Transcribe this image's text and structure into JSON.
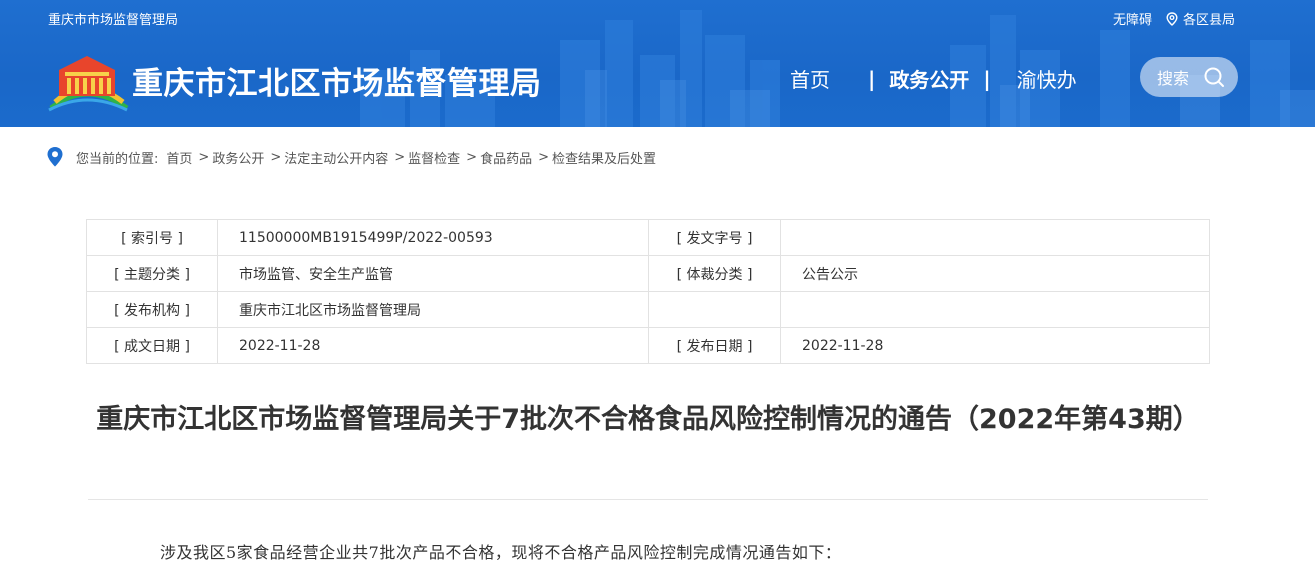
{
  "topbar": {
    "site_name": "重庆市市场监督管理局",
    "accessibility": "无障碍",
    "districts": "各区县局"
  },
  "header": {
    "title": "重庆市江北区市场监督管理局"
  },
  "nav": {
    "items": [
      "首页",
      "政务公开",
      "渝快办"
    ],
    "active_index": 1,
    "search_label": "搜索"
  },
  "breadcrumb": {
    "prefix": "您当前的位置:",
    "items": [
      "首页",
      "政务公开",
      "法定主动公开内容",
      "监督检查",
      "食品药品",
      "检查结果及后处置"
    ]
  },
  "info": {
    "rows": [
      {
        "label1": "[ 索引号 ]",
        "value1": "11500000MB1915499P/2022-00593",
        "label2": "[ 发文字号 ]",
        "value2": ""
      },
      {
        "label1": "[ 主题分类 ]",
        "value1": "市场监管、安全生产监管",
        "label2": "[ 体裁分类 ]",
        "value2": "公告公示"
      },
      {
        "label1": "[ 发布机构 ]",
        "value1": "重庆市江北区市场监督管理局",
        "label2": "",
        "value2": ""
      },
      {
        "label1": "[ 成文日期 ]",
        "value1": "2022-11-28",
        "label2": "[ 发布日期 ]",
        "value2": "2022-11-28"
      }
    ]
  },
  "article": {
    "title": "重庆市江北区市场监督管理局关于7批次不合格食品风险控制情况的通告（2022年第43期）",
    "body_first_line": "涉及我区5家食品经营企业共7批次产品不合格，现将不合格产品风险控制完成情况通告如下："
  },
  "colors": {
    "header_blue": "#1b6bcc",
    "text": "#333333",
    "border": "#e2e2e2"
  },
  "icons": {
    "location": "location-pin-icon",
    "search": "search-icon",
    "logo": "bureau-logo-icon"
  }
}
